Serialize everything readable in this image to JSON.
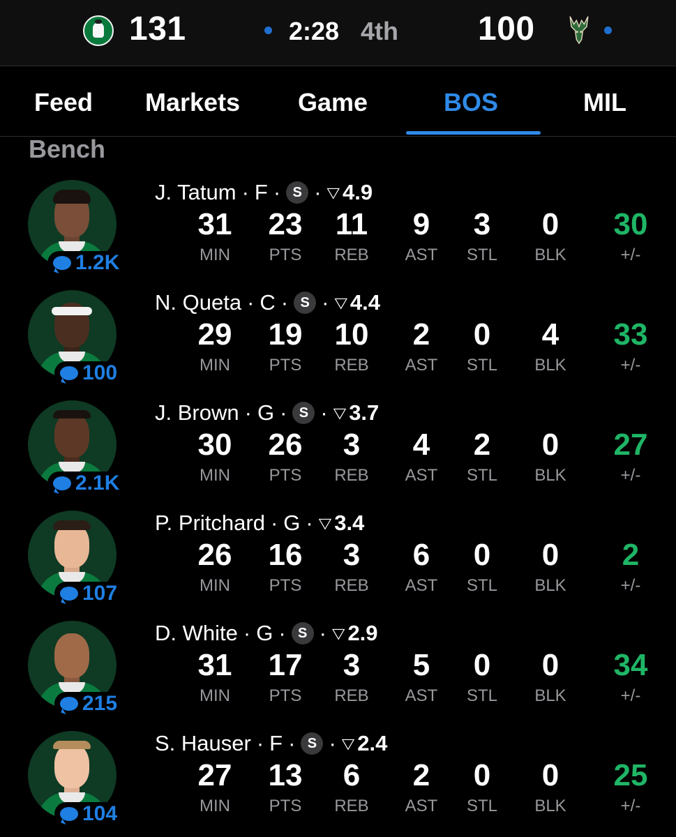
{
  "scoreboard": {
    "home_abbr": "BOS",
    "home_score": "131",
    "away_score": "100",
    "clock": "2:28",
    "period": "4th",
    "colors": {
      "live_dot": "#1f6fd0",
      "bos_green": "#0a7a3c"
    }
  },
  "tabs": [
    {
      "label": "Feed",
      "active": false
    },
    {
      "label": "Markets",
      "active": false
    },
    {
      "label": "Game",
      "active": false
    },
    {
      "label": "BOS",
      "active": true
    },
    {
      "label": "MIL",
      "active": false
    }
  ],
  "section": {
    "title": "Bench"
  },
  "stat_labels": [
    "MIN",
    "PTS",
    "REB",
    "AST",
    "STL",
    "BLK",
    "+/-"
  ],
  "players": [
    {
      "name": "J. Tatum",
      "pos": "F",
      "starter_icon": "S",
      "rating": "4.9",
      "comments": "1.2K",
      "stats": [
        "31",
        "23",
        "11",
        "9",
        "3",
        "0",
        "30"
      ]
    },
    {
      "name": "N. Queta",
      "pos": "C",
      "starter_icon": "S",
      "rating": "4.4",
      "comments": "100",
      "stats": [
        "29",
        "19",
        "10",
        "2",
        "0",
        "4",
        "33"
      ]
    },
    {
      "name": "J. Brown",
      "pos": "G",
      "starter_icon": "S",
      "rating": "3.7",
      "comments": "2.1K",
      "stats": [
        "30",
        "26",
        "3",
        "4",
        "2",
        "0",
        "27"
      ]
    },
    {
      "name": "P. Pritchard",
      "pos": "G",
      "starter_icon": "",
      "rating": "3.4",
      "comments": "107",
      "stats": [
        "26",
        "16",
        "3",
        "6",
        "0",
        "0",
        "2"
      ]
    },
    {
      "name": "D. White",
      "pos": "G",
      "starter_icon": "S",
      "rating": "2.9",
      "comments": "215",
      "stats": [
        "31",
        "17",
        "3",
        "5",
        "0",
        "0",
        "34"
      ]
    },
    {
      "name": "S. Hauser",
      "pos": "F",
      "starter_icon": "S",
      "rating": "2.4",
      "comments": "104",
      "stats": [
        "27",
        "13",
        "6",
        "2",
        "0",
        "0",
        "25"
      ]
    }
  ],
  "icons": {
    "comment": "speech-bubble-icon",
    "trend": "triangle-down-icon",
    "starter": "s-circle-icon"
  }
}
